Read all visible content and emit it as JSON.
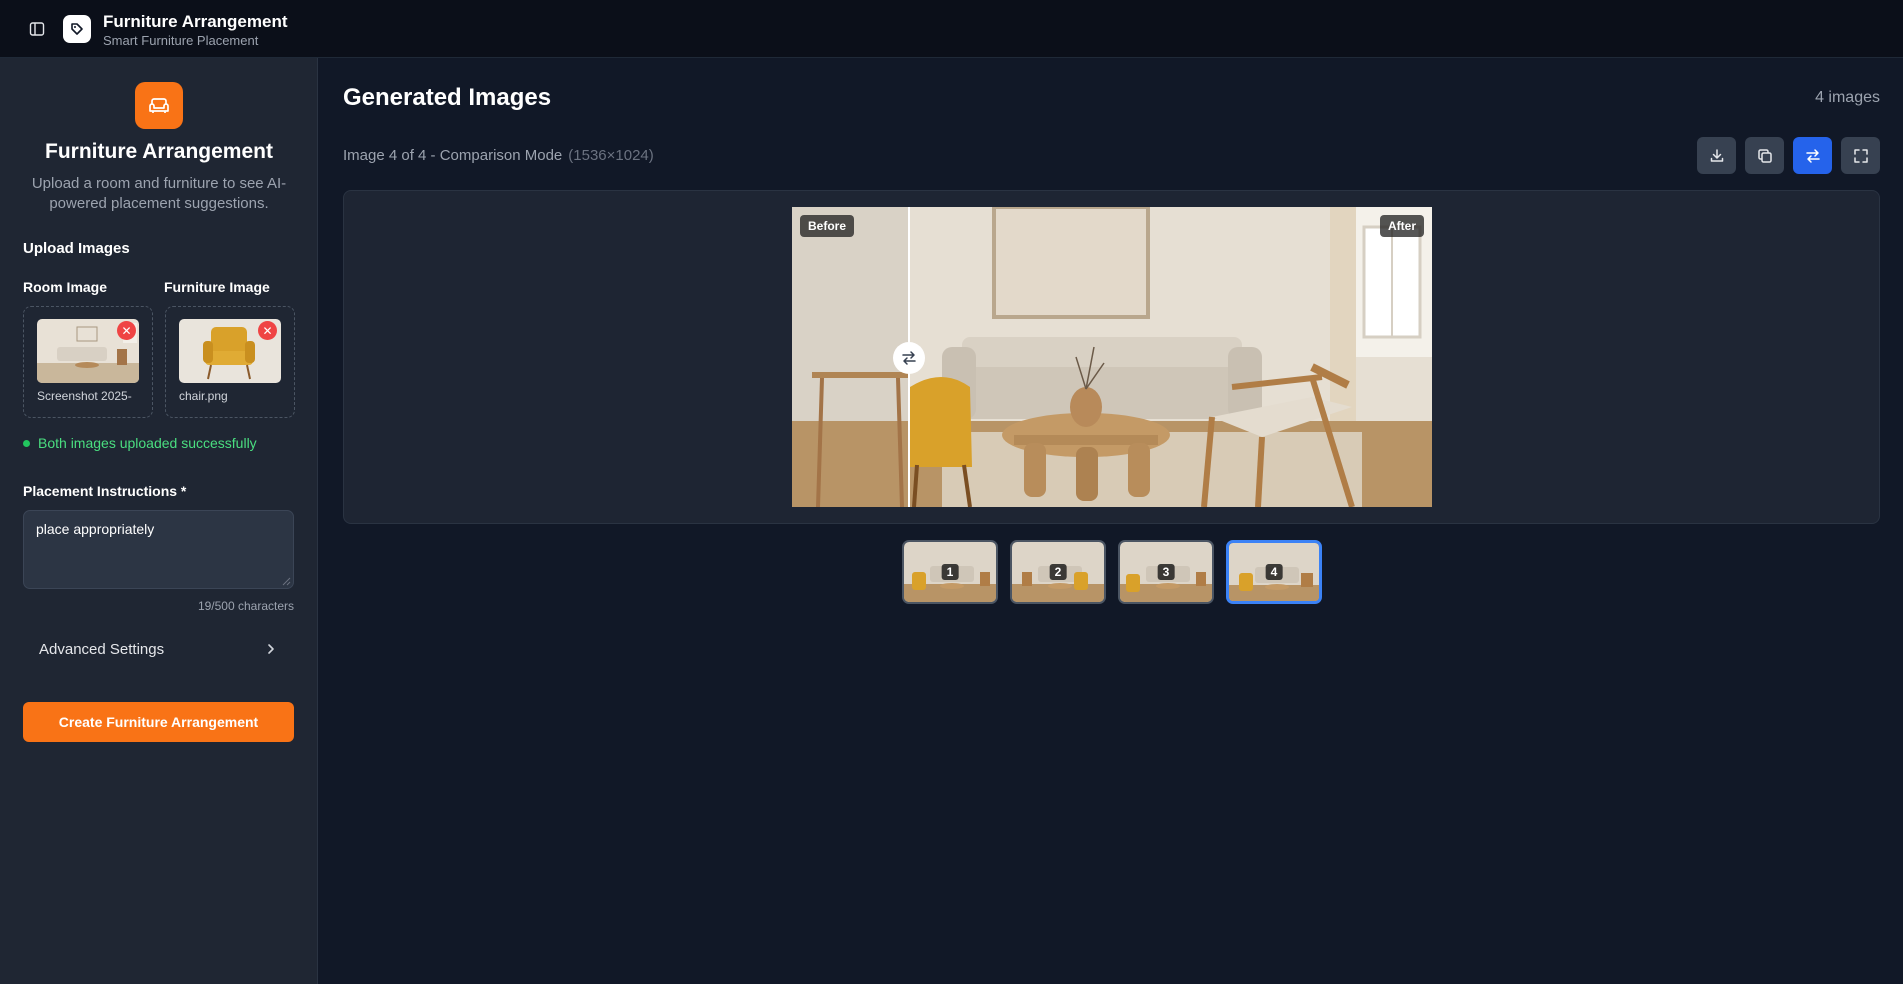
{
  "header": {
    "title": "Furniture Arrangement",
    "subtitle": "Smart Furniture Placement",
    "icons": {
      "sidebar_toggle": "panel-left-icon",
      "logo": "tag-icon"
    }
  },
  "sidebar": {
    "brand_icon": "sofa-icon",
    "heading": "Furniture Arrangement",
    "description": "Upload a room and furniture to see AI-powered placement suggestions.",
    "upload_section": "Upload Images",
    "room": {
      "label": "Room Image",
      "file_name": "Screenshot 2025-"
    },
    "furniture": {
      "label": "Furniture Image",
      "file_name": "chair.png"
    },
    "status": "Both images uploaded successfully",
    "instructions": {
      "label": "Placement Instructions *",
      "value": "place appropriately",
      "char_count": "19/500 characters"
    },
    "advanced_label": "Advanced Settings",
    "create_button": "Create Furniture Arrangement"
  },
  "main": {
    "title": "Generated Images",
    "count": "4 images",
    "info": "Image 4 of 4 - Comparison Mode",
    "dimensions": "(1536×1024)",
    "toolbar": [
      "download-icon",
      "copy-icon",
      "compare-icon",
      "fullscreen-icon"
    ],
    "compare": {
      "before": "Before",
      "after": "After",
      "slider_fraction": 0.18
    },
    "thumbnails": [
      "1",
      "2",
      "3",
      "4"
    ],
    "selected_thumbnail": "4"
  },
  "colors": {
    "accent": "#f97316",
    "active": "#2563eb",
    "success": "#22c55e",
    "danger": "#ef4444"
  }
}
